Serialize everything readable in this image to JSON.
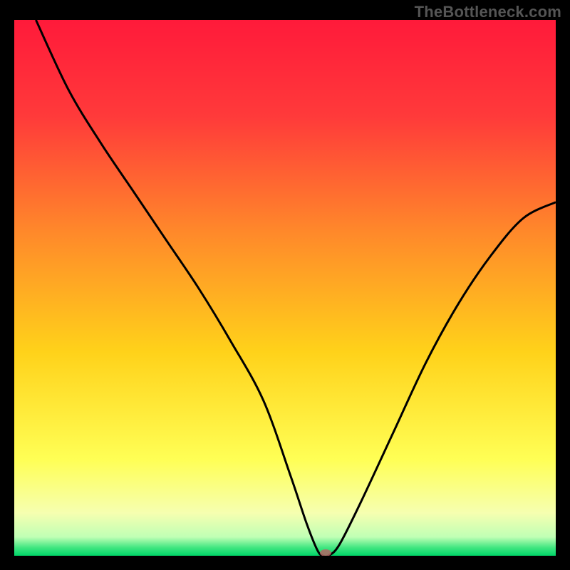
{
  "watermark": "TheBottleneck.com",
  "chart_data": {
    "type": "line",
    "title": "",
    "xlabel": "",
    "ylabel": "",
    "xlim": [
      0,
      100
    ],
    "ylim": [
      0,
      100
    ],
    "background_gradient": {
      "stops": [
        {
          "offset": 0.0,
          "color": "#ff1a3a"
        },
        {
          "offset": 0.18,
          "color": "#ff3a3a"
        },
        {
          "offset": 0.4,
          "color": "#ff8a2a"
        },
        {
          "offset": 0.62,
          "color": "#ffd21a"
        },
        {
          "offset": 0.82,
          "color": "#ffff55"
        },
        {
          "offset": 0.92,
          "color": "#f6ffb0"
        },
        {
          "offset": 0.965,
          "color": "#c0ffb5"
        },
        {
          "offset": 0.985,
          "color": "#40e680"
        },
        {
          "offset": 1.0,
          "color": "#00d568"
        }
      ]
    },
    "series": [
      {
        "name": "bottleneck-curve",
        "color": "#000000",
        "x": [
          4,
          10,
          16,
          22,
          28,
          34,
          40,
          46,
          51,
          54,
          56,
          57,
          58,
          60,
          64,
          70,
          76,
          82,
          88,
          94,
          100
        ],
        "y": [
          100,
          87,
          77,
          68,
          59,
          50,
          40,
          29,
          15,
          6,
          1,
          0,
          0,
          2,
          10,
          23,
          36,
          47,
          56,
          63,
          66
        ]
      }
    ],
    "marker": {
      "name": "optimal-point",
      "x": 57.5,
      "y": 0,
      "color": "#b56565",
      "rx": 8,
      "ry": 5
    }
  }
}
